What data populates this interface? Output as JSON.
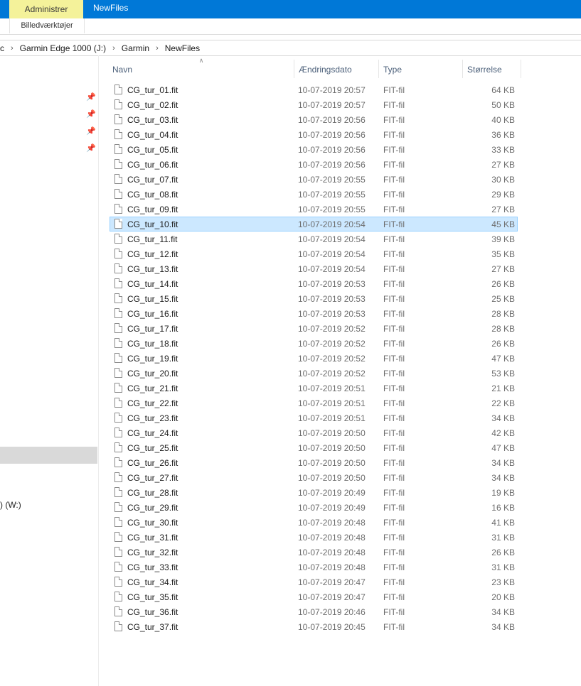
{
  "ribbon": {
    "context_tab": "Administrer",
    "title": "NewFiles",
    "subtab": "Billedværktøjer"
  },
  "address": {
    "crumbs": [
      "c",
      "Garmin Edge 1000 (J:)",
      "Garmin",
      "NewFiles"
    ]
  },
  "nav": {
    "drive_label": ") (W:)"
  },
  "columns": {
    "name": "Navn",
    "date": "Ændringsdato",
    "type": "Type",
    "size": "Størrelse"
  },
  "selected_index": 9,
  "files": [
    {
      "name": "CG_tur_01.fit",
      "date": "10-07-2019 20:57",
      "type": "FIT-fil",
      "size": "64 KB"
    },
    {
      "name": "CG_tur_02.fit",
      "date": "10-07-2019 20:57",
      "type": "FIT-fil",
      "size": "50 KB"
    },
    {
      "name": "CG_tur_03.fit",
      "date": "10-07-2019 20:56",
      "type": "FIT-fil",
      "size": "40 KB"
    },
    {
      "name": "CG_tur_04.fit",
      "date": "10-07-2019 20:56",
      "type": "FIT-fil",
      "size": "36 KB"
    },
    {
      "name": "CG_tur_05.fit",
      "date": "10-07-2019 20:56",
      "type": "FIT-fil",
      "size": "33 KB"
    },
    {
      "name": "CG_tur_06.fit",
      "date": "10-07-2019 20:56",
      "type": "FIT-fil",
      "size": "27 KB"
    },
    {
      "name": "CG_tur_07.fit",
      "date": "10-07-2019 20:55",
      "type": "FIT-fil",
      "size": "30 KB"
    },
    {
      "name": "CG_tur_08.fit",
      "date": "10-07-2019 20:55",
      "type": "FIT-fil",
      "size": "29 KB"
    },
    {
      "name": "CG_tur_09.fit",
      "date": "10-07-2019 20:55",
      "type": "FIT-fil",
      "size": "27 KB"
    },
    {
      "name": "CG_tur_10.fit",
      "date": "10-07-2019 20:54",
      "type": "FIT-fil",
      "size": "45 KB"
    },
    {
      "name": "CG_tur_11.fit",
      "date": "10-07-2019 20:54",
      "type": "FIT-fil",
      "size": "39 KB"
    },
    {
      "name": "CG_tur_12.fit",
      "date": "10-07-2019 20:54",
      "type": "FIT-fil",
      "size": "35 KB"
    },
    {
      "name": "CG_tur_13.fit",
      "date": "10-07-2019 20:54",
      "type": "FIT-fil",
      "size": "27 KB"
    },
    {
      "name": "CG_tur_14.fit",
      "date": "10-07-2019 20:53",
      "type": "FIT-fil",
      "size": "26 KB"
    },
    {
      "name": "CG_tur_15.fit",
      "date": "10-07-2019 20:53",
      "type": "FIT-fil",
      "size": "25 KB"
    },
    {
      "name": "CG_tur_16.fit",
      "date": "10-07-2019 20:53",
      "type": "FIT-fil",
      "size": "28 KB"
    },
    {
      "name": "CG_tur_17.fit",
      "date": "10-07-2019 20:52",
      "type": "FIT-fil",
      "size": "28 KB"
    },
    {
      "name": "CG_tur_18.fit",
      "date": "10-07-2019 20:52",
      "type": "FIT-fil",
      "size": "26 KB"
    },
    {
      "name": "CG_tur_19.fit",
      "date": "10-07-2019 20:52",
      "type": "FIT-fil",
      "size": "47 KB"
    },
    {
      "name": "CG_tur_20.fit",
      "date": "10-07-2019 20:52",
      "type": "FIT-fil",
      "size": "53 KB"
    },
    {
      "name": "CG_tur_21.fit",
      "date": "10-07-2019 20:51",
      "type": "FIT-fil",
      "size": "21 KB"
    },
    {
      "name": "CG_tur_22.fit",
      "date": "10-07-2019 20:51",
      "type": "FIT-fil",
      "size": "22 KB"
    },
    {
      "name": "CG_tur_23.fit",
      "date": "10-07-2019 20:51",
      "type": "FIT-fil",
      "size": "34 KB"
    },
    {
      "name": "CG_tur_24.fit",
      "date": "10-07-2019 20:50",
      "type": "FIT-fil",
      "size": "42 KB"
    },
    {
      "name": "CG_tur_25.fit",
      "date": "10-07-2019 20:50",
      "type": "FIT-fil",
      "size": "47 KB"
    },
    {
      "name": "CG_tur_26.fit",
      "date": "10-07-2019 20:50",
      "type": "FIT-fil",
      "size": "34 KB"
    },
    {
      "name": "CG_tur_27.fit",
      "date": "10-07-2019 20:50",
      "type": "FIT-fil",
      "size": "34 KB"
    },
    {
      "name": "CG_tur_28.fit",
      "date": "10-07-2019 20:49",
      "type": "FIT-fil",
      "size": "19 KB"
    },
    {
      "name": "CG_tur_29.fit",
      "date": "10-07-2019 20:49",
      "type": "FIT-fil",
      "size": "16 KB"
    },
    {
      "name": "CG_tur_30.fit",
      "date": "10-07-2019 20:48",
      "type": "FIT-fil",
      "size": "41 KB"
    },
    {
      "name": "CG_tur_31.fit",
      "date": "10-07-2019 20:48",
      "type": "FIT-fil",
      "size": "31 KB"
    },
    {
      "name": "CG_tur_32.fit",
      "date": "10-07-2019 20:48",
      "type": "FIT-fil",
      "size": "26 KB"
    },
    {
      "name": "CG_tur_33.fit",
      "date": "10-07-2019 20:48",
      "type": "FIT-fil",
      "size": "31 KB"
    },
    {
      "name": "CG_tur_34.fit",
      "date": "10-07-2019 20:47",
      "type": "FIT-fil",
      "size": "23 KB"
    },
    {
      "name": "CG_tur_35.fit",
      "date": "10-07-2019 20:47",
      "type": "FIT-fil",
      "size": "20 KB"
    },
    {
      "name": "CG_tur_36.fit",
      "date": "10-07-2019 20:46",
      "type": "FIT-fil",
      "size": "34 KB"
    },
    {
      "name": "CG_tur_37.fit",
      "date": "10-07-2019 20:45",
      "type": "FIT-fil",
      "size": "34 KB"
    }
  ],
  "colors": {
    "ribbon_blue": "#0078d7",
    "context_tab_bg": "#f4f29a",
    "selection_bg": "#cce8ff",
    "selection_border": "#99d1ff"
  }
}
